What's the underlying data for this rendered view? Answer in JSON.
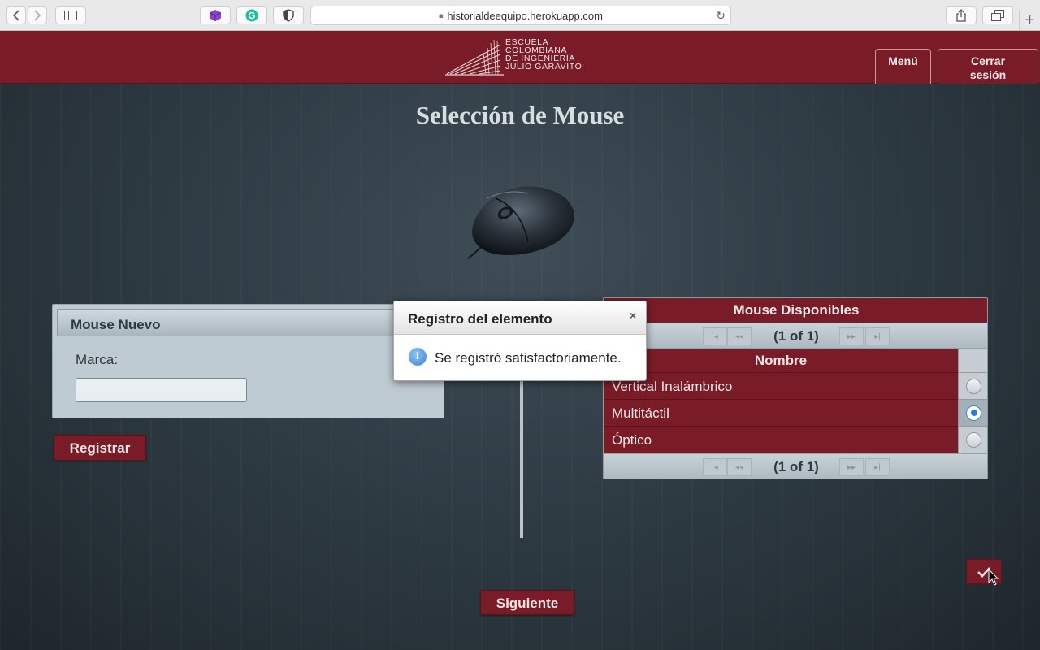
{
  "browser": {
    "url": "historialdeequipo.herokuapp.com",
    "new_tab": "+"
  },
  "header": {
    "logo_lines": [
      "ESCUELA",
      "COLOMBIANA",
      "DE INGENIERÍA",
      "JULIO GARAVITO"
    ],
    "menu_label": "Menú",
    "logout_line1": "Cerrar",
    "logout_line2": "sesión"
  },
  "page": {
    "title": "Selección de Mouse"
  },
  "new_mouse_panel": {
    "title": "Mouse Nuevo",
    "brand_label": "Marca:",
    "brand_value": "",
    "register_label": "Registrar"
  },
  "available_table": {
    "title": "Mouse Disponibles",
    "pager_text": "(1 of 1)",
    "column_name": "Nombre",
    "rows": [
      {
        "name": "Vertical Inalámbrico",
        "selected": false
      },
      {
        "name": "Multitáctil",
        "selected": true
      },
      {
        "name": "Óptico",
        "selected": false
      }
    ]
  },
  "dialog": {
    "title": "Registro del elemento",
    "close": "×",
    "message": "Se registró satisfactoriamente."
  },
  "footer": {
    "next_label": "Siguiente"
  },
  "colors": {
    "brand_red": "#7a1c27",
    "panel_gray": "#bfcbd3",
    "radio_blue": "#2a7bd6"
  }
}
